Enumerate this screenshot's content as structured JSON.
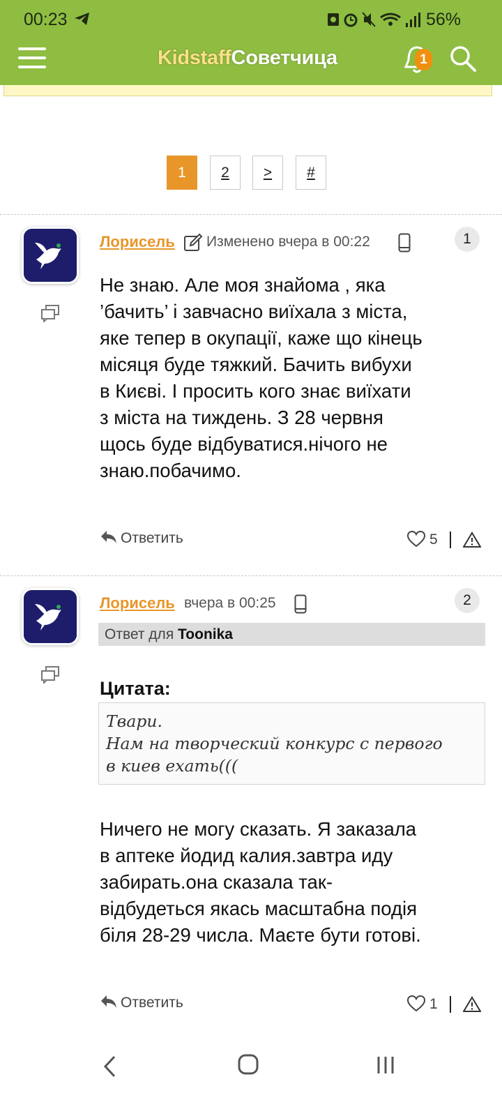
{
  "status_bar": {
    "time": "00:23",
    "battery": "56%"
  },
  "app_bar": {
    "brand_part1": "Kidstaff",
    "brand_part2": "Советчица",
    "notification_count": "1"
  },
  "pagination": {
    "pages": [
      "1",
      "2",
      ">",
      "#"
    ],
    "active": "1"
  },
  "posts": [
    {
      "author": "Лорисель",
      "meta": "Изменено вчера в 00:22",
      "number": "1",
      "body_lines": [
        "Не знаю. Але моя знайома , яка",
        "’бачить’ і завчасно виїхала з міста,",
        "яке тепер в окупації, каже що кінець",
        "місяця буде тяжкий. Бачить вибухи",
        "в Києві. І просить кого знає виїхати",
        "з міста на тиждень. З 28 червня",
        "щось буде відбуватися.нічого не",
        "знаю.побачимо."
      ],
      "reply_label": "Ответить",
      "likes": "5"
    },
    {
      "author": "Лорисель",
      "meta": "вчера в 00:25",
      "number": "2",
      "reply_to_prefix": "Ответ для",
      "reply_to_user": "Toonika",
      "quote_title": "Цитата:",
      "quote_lines": [
        "Твари.",
        "Нам на творческий конкурс с первого",
        "в киев ехать((("
      ],
      "body_lines": [
        "Ничего не могу сказать. Я заказала",
        "в аптеке йодид калия.завтра иду",
        "забирать.она сказала так-",
        "відбудеться якась масштабна подія",
        "біля 28-29 числа. Маєте бути готові."
      ],
      "reply_label": "Ответить",
      "likes": "1"
    }
  ]
}
